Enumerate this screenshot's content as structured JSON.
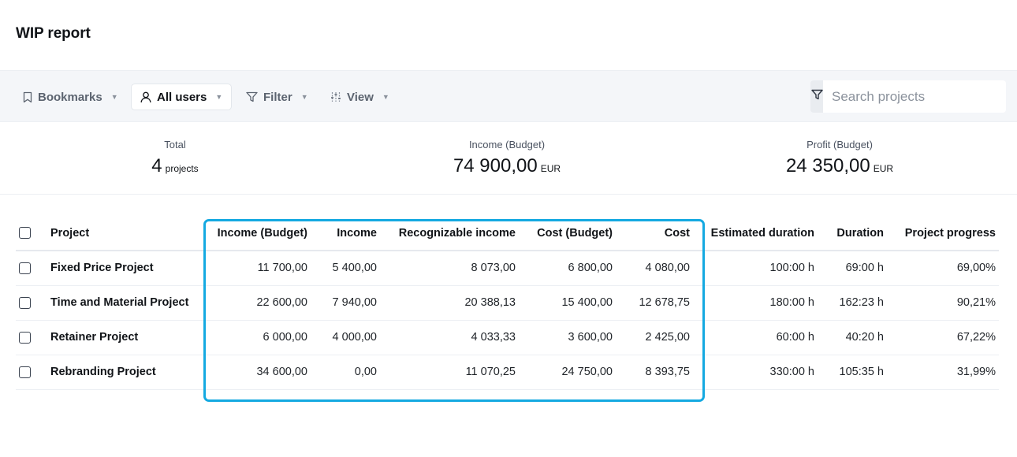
{
  "title": "WIP report",
  "toolbar": {
    "bookmarks": "Bookmarks",
    "users": "All users",
    "filter": "Filter",
    "view": "View",
    "search_placeholder": "Search projects"
  },
  "stats": {
    "total": {
      "label": "Total",
      "value": "4",
      "unit": "projects"
    },
    "income": {
      "label": "Income (Budget)",
      "value": "74 900,00",
      "unit": "EUR"
    },
    "profit": {
      "label": "Profit (Budget)",
      "value": "24 350,00",
      "unit": "EUR"
    }
  },
  "table": {
    "headers": [
      "Project",
      "Income (Budget)",
      "Income",
      "Recognizable income",
      "Cost (Budget)",
      "Cost",
      "Estimated duration",
      "Duration",
      "Project progress"
    ],
    "rows": [
      [
        "Fixed Price Project",
        "11 700,00",
        "5 400,00",
        "8 073,00",
        "6 800,00",
        "4 080,00",
        "100:00 h",
        "69:00 h",
        "69,00%"
      ],
      [
        "Time and Material Project",
        "22 600,00",
        "7 940,00",
        "20 388,13",
        "15 400,00",
        "12 678,75",
        "180:00 h",
        "162:23 h",
        "90,21%"
      ],
      [
        "Retainer Project",
        "6 000,00",
        "4 000,00",
        "4 033,33",
        "3 600,00",
        "2 425,00",
        "60:00 h",
        "40:20 h",
        "67,22%"
      ],
      [
        "Rebranding Project",
        "34 600,00",
        "0,00",
        "11 070,25",
        "24 750,00",
        "8 393,75",
        "330:00 h",
        "105:35 h",
        "31,99%"
      ]
    ]
  },
  "colors": {
    "highlight_border": "#14a9e1",
    "toolbar_bg": "#f4f6f9"
  },
  "icons": {
    "bookmarks": "bookmark-icon",
    "users": "user-icon",
    "filter": "filter-icon",
    "view": "sliders-icon",
    "search": "filter-icon"
  }
}
